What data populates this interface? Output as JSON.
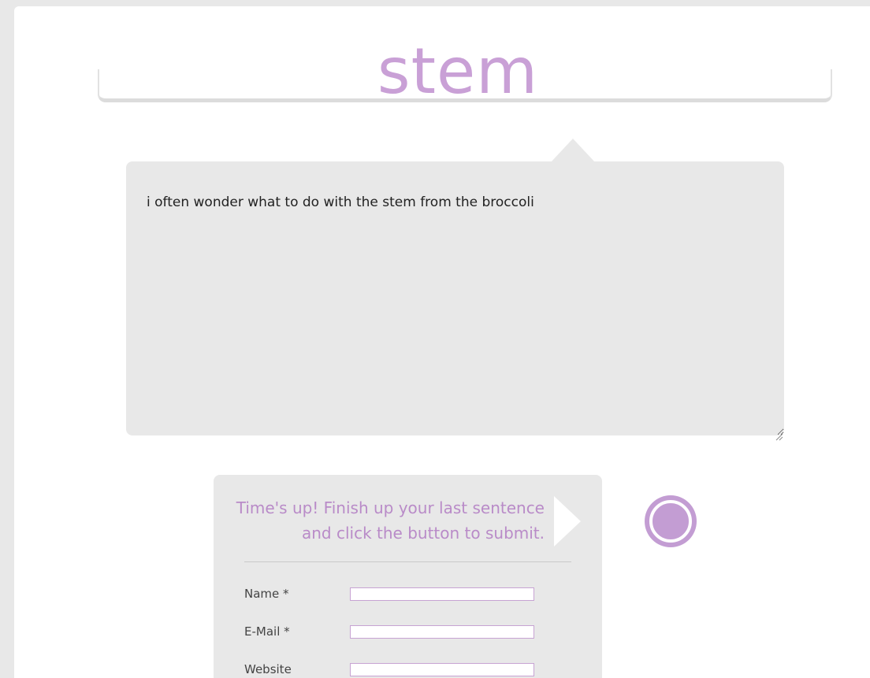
{
  "prompt": {
    "word": "stem"
  },
  "editor": {
    "text": "i often wonder what to do with the stem from the broccoli"
  },
  "submit_panel": {
    "line1": "Time's up! Finish up your last sentence",
    "line2": "and click the button to submit.",
    "fields": {
      "name_label": "Name *",
      "name_value": "",
      "email_label": "E-Mail *",
      "email_value": "",
      "website_label": "Website",
      "website_value": ""
    }
  },
  "colors": {
    "accent": "#c9a0d6",
    "panel": "#e8e8e8",
    "button": "#c39dd3"
  }
}
